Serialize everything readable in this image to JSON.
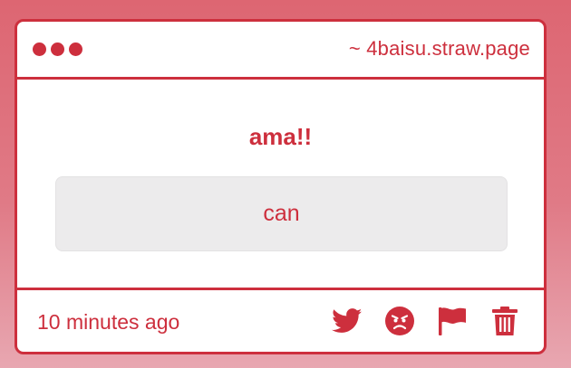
{
  "header": {
    "site": "~ 4baisu.straw.page"
  },
  "message": {
    "question": "ama!!",
    "answer": "can"
  },
  "footer": {
    "timestamp": "10 minutes ago",
    "actions": [
      {
        "icon": "twitter-icon"
      },
      {
        "icon": "angry-face-icon"
      },
      {
        "icon": "flag-icon"
      },
      {
        "icon": "trash-icon"
      }
    ]
  },
  "colors": {
    "accent": "#cd2f3d",
    "answer_bg": "#ecebec",
    "background": "#e07a86"
  }
}
